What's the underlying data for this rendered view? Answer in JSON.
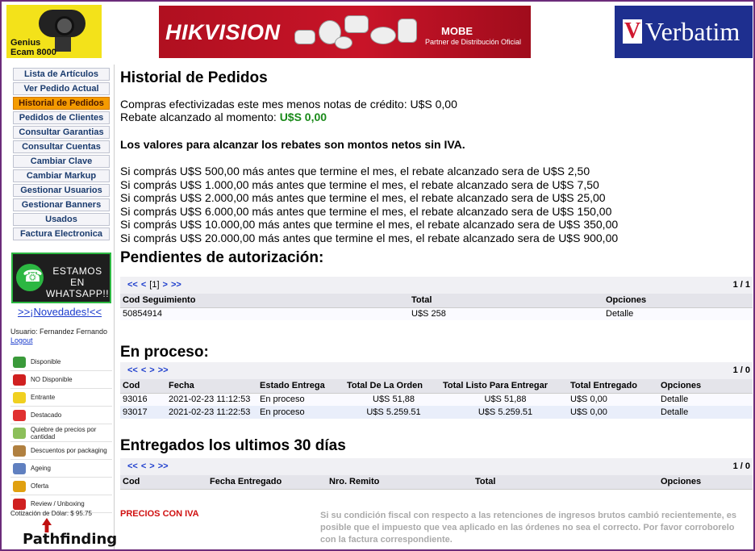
{
  "banners": {
    "genius": {
      "line1": "Genius",
      "line2": "Ecam 8000"
    },
    "hikvision": {
      "logo": "HIKVISION",
      "partner_brand": "MOBE",
      "partner_text": "Partner de Distribución Oficial"
    },
    "verbatim": {
      "logo": "Verbatim"
    }
  },
  "sidebar": {
    "menu": [
      {
        "label": "Lista de Artículos"
      },
      {
        "label": "Ver Pedido Actual"
      },
      {
        "label": "Historial de Pedidos"
      },
      {
        "label": "Pedidos de Clientes"
      },
      {
        "label": "Consultar Garantias"
      },
      {
        "label": "Consultar Cuentas"
      },
      {
        "label": "Cambiar Clave"
      },
      {
        "label": "Cambiar Markup"
      },
      {
        "label": "Gestionar Usuarios"
      },
      {
        "label": "Gestionar Banners"
      },
      {
        "label": "Usados"
      },
      {
        "label": "Factura Electronica"
      }
    ],
    "active_index": 2,
    "whatsapp_text": "ESTAMOS EN WHATSAPP!!",
    "novedades": ">>¡Novedades!<<",
    "usuario": "Usuario: Fernandez Fernando",
    "logout": "Logout",
    "legend": [
      {
        "label": "Disponible",
        "icon": "thumbs-up-icon",
        "color": "#3a9a3a"
      },
      {
        "label": "NO Disponible",
        "icon": "thumbs-down-icon",
        "color": "#d02020"
      },
      {
        "label": "Entrante",
        "icon": "incoming-icon",
        "color": "#f0d020"
      },
      {
        "label": "Destacado",
        "icon": "star-badge-icon",
        "color": "#e03030"
      },
      {
        "label": "Quiebre de precios por cantidad",
        "icon": "price-break-icon",
        "color": "#8cbf5a"
      },
      {
        "label": "Descuentos por packaging",
        "icon": "package-icon",
        "color": "#b08040"
      },
      {
        "label": "Ageing",
        "icon": "eye-icon",
        "color": "#6080c0"
      },
      {
        "label": "Oferta",
        "icon": "trophy-icon",
        "color": "#e0a010"
      },
      {
        "label": "Review / Unboxing",
        "icon": "youtube-icon",
        "color": "#d02020"
      }
    ],
    "cotizacion": "Cotización de Dólar: $ 95.75",
    "footer_logo": "Pathfinding"
  },
  "main": {
    "title": "Historial de Pedidos",
    "compras": "Compras efectivizadas este mes menos notas de crédito: U$S 0,00",
    "rebate_label": "Rebate alcanzado al momento: ",
    "rebate_value": "U$S 0,00",
    "rebate_note": "Los valores para alcanzar los rebates son montos netos sin IVA.",
    "rebate_lines": [
      "Si comprás U$S 500,00 más antes que termine el mes, el rebate alcanzado sera de U$S 2,50",
      "Si comprás U$S 1.000,00 más antes que termine el mes, el rebate alcanzado sera de U$S 7,50",
      "Si comprás U$S 2.000,00 más antes que termine el mes, el rebate alcanzado sera de U$S 25,00",
      "Si comprás U$S 6.000,00 más antes que termine el mes, el rebate alcanzado sera de U$S 150,00",
      "Si comprás U$S 10.000,00 más antes que termine el mes, el rebate alcanzado sera de U$S 350,00",
      "Si comprás U$S 20.000,00 más antes que termine el mes, el rebate alcanzado sera de U$S 900,00"
    ],
    "pendientes": {
      "title": "Pendientes de autorización:",
      "pager": {
        "first": "<<",
        "prev": "<",
        "page": "[1]",
        "next": ">",
        "last": ">>",
        "count": "1 / 1"
      },
      "headers": [
        "Cod Seguimiento",
        "Total",
        "Opciones"
      ],
      "rows": [
        [
          "50854914",
          "U$S 258",
          "Detalle"
        ]
      ]
    },
    "en_proceso": {
      "title": "En proceso:",
      "pager": {
        "first": "<<",
        "prev": "<",
        "next": ">",
        "last": ">>",
        "count": "1 / 0"
      },
      "headers": [
        "Cod",
        "Fecha",
        "Estado Entrega",
        "Total De La Orden",
        "Total Listo Para Entregar",
        "Total Entregado",
        "Opciones"
      ],
      "rows": [
        [
          "93016",
          "2021-02-23 11:12:53",
          "En proceso",
          "U$S 51,88",
          "U$S 51,88",
          "U$S 0,00",
          "Detalle"
        ],
        [
          "93017",
          "2021-02-23 11:22:53",
          "En proceso",
          "U$S 5.259.51",
          "U$S 5.259.51",
          "U$S 0,00",
          "Detalle"
        ]
      ]
    },
    "entregados": {
      "title": "Entregados los ultimos 30 días",
      "pager": {
        "first": "<<",
        "prev": "<",
        "next": ">",
        "last": ">>",
        "count": "1 / 0"
      },
      "headers": [
        "Cod",
        "Fecha Entregado",
        "Nro. Remito",
        "Total",
        "Opciones"
      ]
    },
    "precios_iva": "PRECIOS CON IVA",
    "fiscal_note": "Si su condición fiscal con respecto a las retenciones de ingresos brutos cambió recientemente, es posible que el impuesto que vea aplicado en las órdenes no sea el correcto. Por favor corroborelo con la factura correspondiente."
  }
}
